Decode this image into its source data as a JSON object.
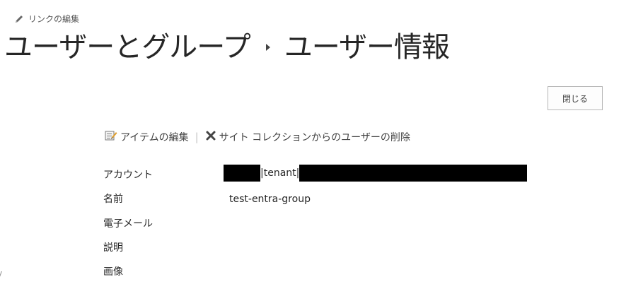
{
  "edit_links": {
    "label": "リンクの編集",
    "icon": "pencil-icon"
  },
  "breadcrumb": {
    "parent": "ユーザーとグループ",
    "separator_icon": "chevron-right-icon",
    "current": "ユーザー情報"
  },
  "close_button": {
    "label": "閉じる"
  },
  "toolbar": {
    "edit_item": {
      "label": "アイテムの編集",
      "icon": "edit-item-icon"
    },
    "remove_user": {
      "label": "サイト コレクションからのユーザーの削除",
      "icon": "delete-x-icon"
    }
  },
  "fields": [
    {
      "label": "アカウント",
      "value": "|tenant|"
    },
    {
      "label": "名前",
      "value": "test-entra-group"
    },
    {
      "label": "電子メール",
      "value": ""
    },
    {
      "label": "説明",
      "value": ""
    },
    {
      "label": "画像",
      "value": ""
    }
  ]
}
